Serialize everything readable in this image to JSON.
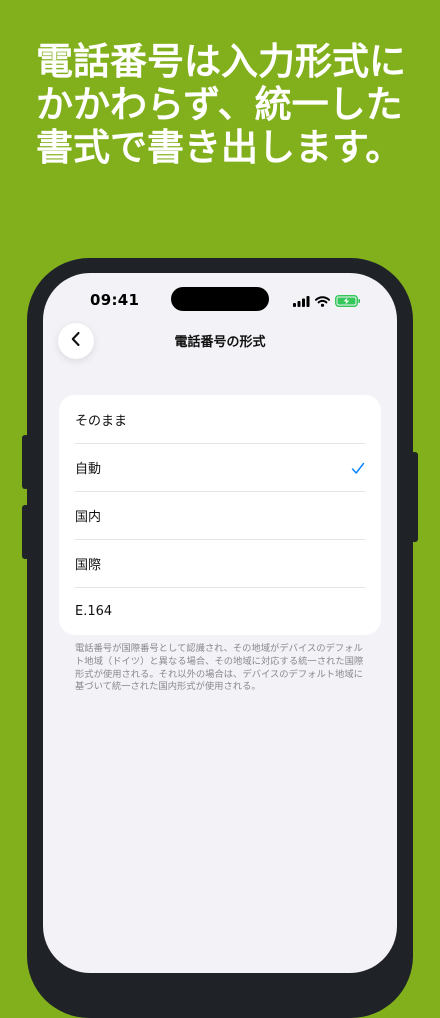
{
  "promo": {
    "headline_lines": [
      "電話番号は入力形式に",
      "かかわらず、統一した",
      "書式で書き出します。"
    ]
  },
  "status_bar": {
    "time": "09:41",
    "icons": [
      "signal-bars-icon",
      "wifi-icon",
      "battery-charging-icon"
    ]
  },
  "nav": {
    "back_icon": "chevron-left-icon",
    "title": "電話番号の形式"
  },
  "options": [
    {
      "label": "そのまま",
      "selected": false
    },
    {
      "label": "自動",
      "selected": true
    },
    {
      "label": "国内",
      "selected": false
    },
    {
      "label": "国際",
      "selected": false
    },
    {
      "label": "E.164",
      "selected": false
    }
  ],
  "footnote": "電話番号が国際番号として認識され、その地域がデバイスのデフォルト地域（ドイツ）と異なる場合、その地域に対応する統一された国際形式が使用される。それ以外の場合は、デバイスのデフォルト地域に基づいて統一された国内形式が使用される。",
  "colors": {
    "background": "#82B01C",
    "accent": "#0A84FF",
    "battery": "#34C759",
    "frame": "#1F2328",
    "screen": "#F2F2F7"
  }
}
